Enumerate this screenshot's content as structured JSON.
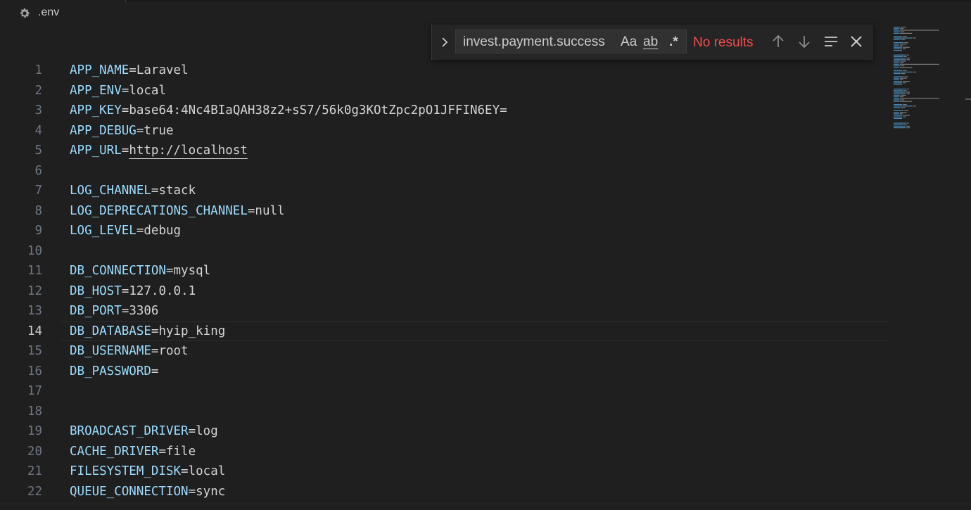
{
  "tab": {
    "filename": ".env",
    "icon": "gear-icon"
  },
  "find": {
    "query": "invest.payment.success",
    "match_case_label": "Aa",
    "whole_word_label": "ab",
    "regex_label": ".*",
    "status": "No results"
  },
  "editor": {
    "current_line": 14,
    "lines": [
      {
        "n": "1",
        "key": "APP_NAME",
        "eq": "=",
        "val": "Laravel"
      },
      {
        "n": "2",
        "key": "APP_ENV",
        "eq": "=",
        "val": "local"
      },
      {
        "n": "3",
        "key": "APP_KEY",
        "eq": "=",
        "val": "base64:4Nc4BIaQAH38z2+sS7/56k0g3KOtZpc2pO1JFFIN6EY="
      },
      {
        "n": "4",
        "key": "APP_DEBUG",
        "eq": "=",
        "val": "true"
      },
      {
        "n": "5",
        "key": "APP_URL",
        "eq": "=",
        "val": "http://localhost"
      },
      {
        "n": "6",
        "key": "",
        "eq": "",
        "val": ""
      },
      {
        "n": "7",
        "key": "LOG_CHANNEL",
        "eq": "=",
        "val": "stack"
      },
      {
        "n": "8",
        "key": "LOG_DEPRECATIONS_CHANNEL",
        "eq": "=",
        "val": "null"
      },
      {
        "n": "9",
        "key": "LOG_LEVEL",
        "eq": "=",
        "val": "debug"
      },
      {
        "n": "10",
        "key": "",
        "eq": "",
        "val": ""
      },
      {
        "n": "11",
        "key": "DB_CONNECTION",
        "eq": "=",
        "val": "mysql"
      },
      {
        "n": "12",
        "key": "DB_HOST",
        "eq": "=",
        "val": "127.0.0.1"
      },
      {
        "n": "13",
        "key": "DB_PORT",
        "eq": "=",
        "val": "3306"
      },
      {
        "n": "14",
        "key": "DB_DATABASE",
        "eq": "=",
        "val": "hyip_king"
      },
      {
        "n": "15",
        "key": "DB_USERNAME",
        "eq": "=",
        "val": "root"
      },
      {
        "n": "16",
        "key": "DB_PASSWORD",
        "eq": "=",
        "val": ""
      },
      {
        "n": "17",
        "key": "",
        "eq": "",
        "val": ""
      },
      {
        "n": "18",
        "key": "",
        "eq": "",
        "val": ""
      },
      {
        "n": "19",
        "key": "BROADCAST_DRIVER",
        "eq": "=",
        "val": "log"
      },
      {
        "n": "20",
        "key": "CACHE_DRIVER",
        "eq": "=",
        "val": "file"
      },
      {
        "n": "21",
        "key": "FILESYSTEM_DISK",
        "eq": "=",
        "val": "local"
      },
      {
        "n": "22",
        "key": "QUEUE_CONNECTION",
        "eq": "=",
        "val": "sync"
      }
    ]
  },
  "colors": {
    "background": "#1f1f1f",
    "key": "#9cdcfe",
    "value": "#d4d4d4",
    "line_number": "#6e7681",
    "no_results": "#f14c4c"
  }
}
